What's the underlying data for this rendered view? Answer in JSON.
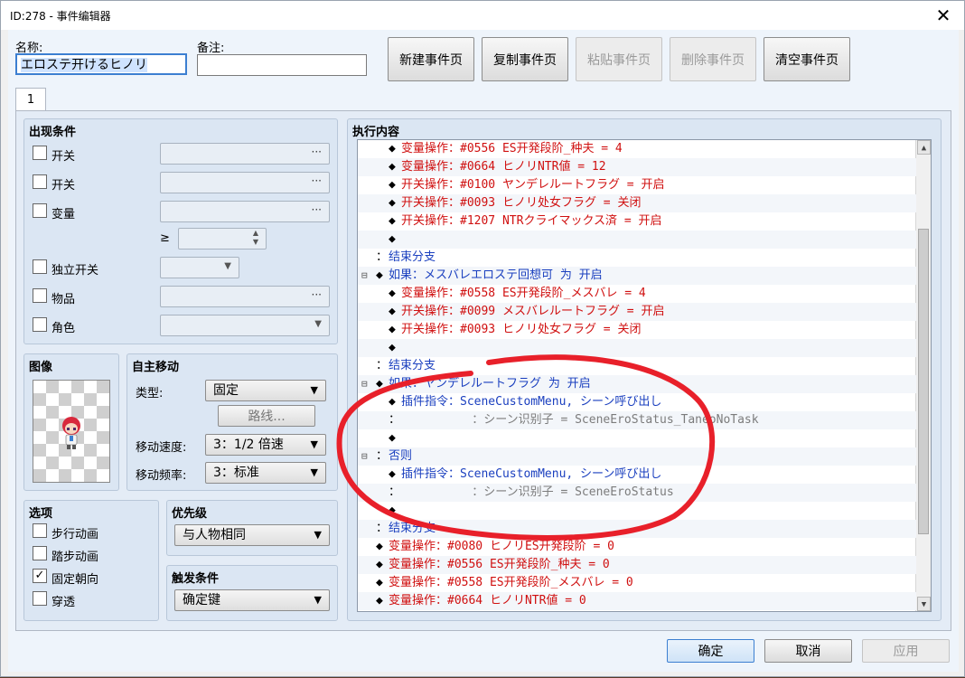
{
  "window": {
    "title": "ID:278 - 事件编辑器",
    "close_glyph": "✕"
  },
  "header": {
    "name_label": "名称:",
    "name_value": "エロステ开けるヒノリ",
    "note_label": "备注:",
    "note_value": "",
    "buttons": {
      "new_page": "新建事件页",
      "copy_page": "复制事件页",
      "paste_page": "粘贴事件页",
      "delete_page": "删除事件页",
      "clear_page": "清空事件页"
    }
  },
  "tabs": [
    {
      "label": "1"
    }
  ],
  "conditions": {
    "title": "出现条件",
    "switch1": "开关",
    "switch2": "开关",
    "variable": "变量",
    "ge_symbol": "≥",
    "self_switch": "独立开关",
    "item": "物品",
    "actor": "角色",
    "dots": "···"
  },
  "image": {
    "title": "图像"
  },
  "autonomous": {
    "title": "自主移动",
    "type_label": "类型:",
    "type_value": "固定",
    "route_button": "路线...",
    "speed_label": "移动速度:",
    "speed_value": "3：1/2 倍速",
    "freq_label": "移动频率:",
    "freq_value": "3：标准"
  },
  "options": {
    "title": "选项",
    "walking": {
      "label": "步行动画",
      "checked": false
    },
    "stepping": {
      "label": "踏步动画",
      "checked": false
    },
    "direction_fix": {
      "label": "固定朝向",
      "checked": true
    },
    "through": {
      "label": "穿透",
      "checked": false
    },
    "check_glyph": "✓"
  },
  "priority": {
    "title": "优先级",
    "value": "与人物相同"
  },
  "trigger": {
    "title": "触发条件",
    "value": "确定键"
  },
  "contents": {
    "title": "执行内容",
    "lines": [
      {
        "indent": 2,
        "bullet": "◆",
        "text": "变量操作：#0556 ES开発段阶_种夫 = 4",
        "color": "red"
      },
      {
        "indent": 2,
        "bullet": "◆",
        "text": "变量操作：#0664 ヒノリNTR値 = 12",
        "color": "red"
      },
      {
        "indent": 2,
        "bullet": "◆",
        "text": "开关操作：#0100 ヤンデレルートフラグ = 开启",
        "color": "red"
      },
      {
        "indent": 2,
        "bullet": "◆",
        "text": "开关操作：#0093 ヒノリ处女フラグ = 关闭",
        "color": "red"
      },
      {
        "indent": 2,
        "bullet": "◆",
        "text": "开关操作：#1207 NTRクライマックス済 = 开启",
        "color": "red"
      },
      {
        "indent": 2,
        "bullet": "◆",
        "text": "",
        "color": "black"
      },
      {
        "indent": 1,
        "bullet": "：",
        "text": "结束分支",
        "color": "blue"
      },
      {
        "indent": 1,
        "bullet": "◆",
        "text": "如果：メスバレエロステ回想可 为 开启",
        "color": "blue",
        "collapse": "⊟"
      },
      {
        "indent": 2,
        "bullet": "◆",
        "text": "变量操作：#0558 ES开発段阶_メスバレ = 4",
        "color": "red"
      },
      {
        "indent": 2,
        "bullet": "◆",
        "text": "开关操作：#0099 メスバレルートフラグ = 开启",
        "color": "red"
      },
      {
        "indent": 2,
        "bullet": "◆",
        "text": "开关操作：#0093 ヒノリ处女フラグ = 关闭",
        "color": "red"
      },
      {
        "indent": 2,
        "bullet": "◆",
        "text": "",
        "color": "black"
      },
      {
        "indent": 1,
        "bullet": "：",
        "text": "结束分支",
        "color": "blue"
      },
      {
        "indent": 1,
        "bullet": "◆",
        "text": "如果：ヤンデレルートフラグ 为 开启",
        "color": "blue",
        "collapse": "⊟"
      },
      {
        "indent": 2,
        "bullet": "◆",
        "text": "插件指令：SceneCustomMenu, シーン呼び出し",
        "color": "blue"
      },
      {
        "indent": 2,
        "bullet": "：",
        "text": "          ：シーン识别子 = SceneEroStatus_TaneoNoTask",
        "color": "gray"
      },
      {
        "indent": 2,
        "bullet": "◆",
        "text": "",
        "color": "black"
      },
      {
        "indent": 1,
        "bullet": "：",
        "text": "否则",
        "color": "blue",
        "collapse": "⊟"
      },
      {
        "indent": 2,
        "bullet": "◆",
        "text": "插件指令：SceneCustomMenu, シーン呼び出し",
        "color": "blue"
      },
      {
        "indent": 2,
        "bullet": "：",
        "text": "          ：シーン识别子 = SceneEroStatus",
        "color": "gray"
      },
      {
        "indent": 2,
        "bullet": "◆",
        "text": "",
        "color": "black"
      },
      {
        "indent": 1,
        "bullet": "：",
        "text": "结束分支",
        "color": "blue"
      },
      {
        "indent": 1,
        "bullet": "◆",
        "text": "变量操作：#0080 ヒノリES开発段阶 = 0",
        "color": "red"
      },
      {
        "indent": 1,
        "bullet": "◆",
        "text": "变量操作：#0556 ES开発段阶_种夫 = 0",
        "color": "red"
      },
      {
        "indent": 1,
        "bullet": "◆",
        "text": "变量操作：#0558 ES开発段阶_メスバレ = 0",
        "color": "red"
      },
      {
        "indent": 1,
        "bullet": "◆",
        "text": "变量操作：#0664 ヒノリNTR値 = 0",
        "color": "red"
      }
    ]
  },
  "footer": {
    "ok": "确定",
    "cancel": "取消",
    "apply": "应用"
  },
  "colors": {
    "annotation": "#e8202a",
    "command_red": "#d01010",
    "command_blue": "#1a3fbf"
  }
}
